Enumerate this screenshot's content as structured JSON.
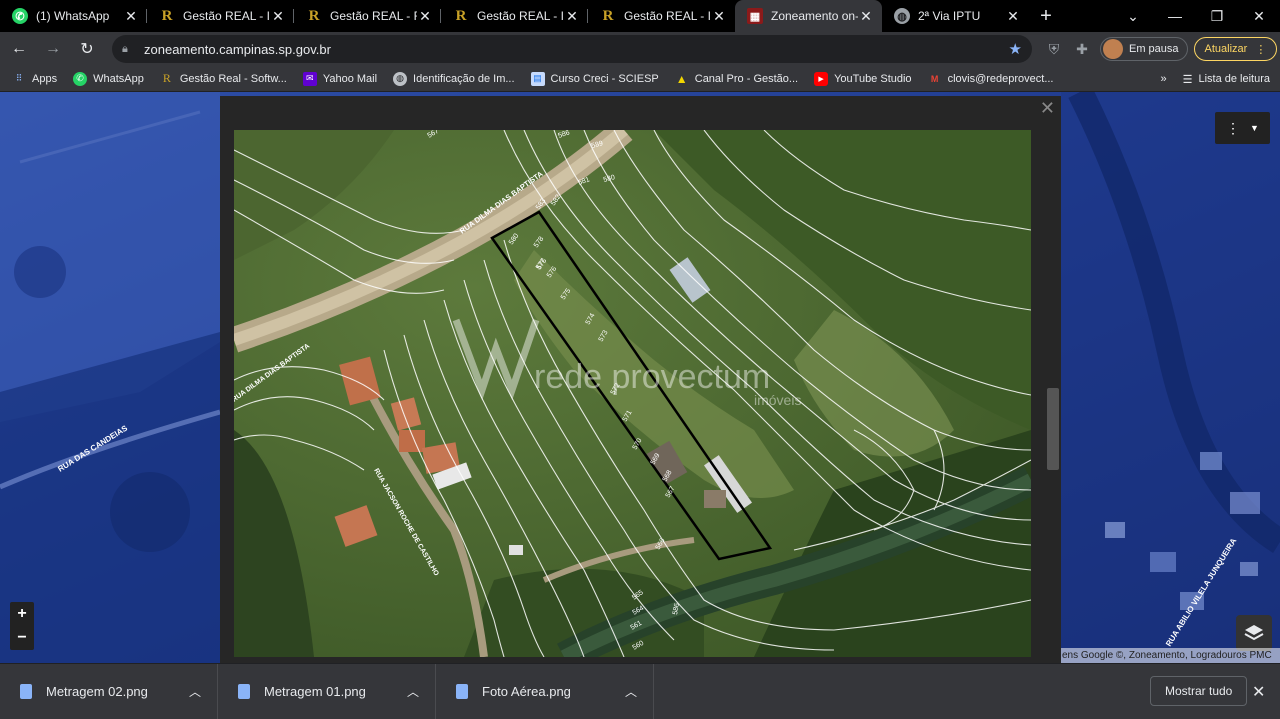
{
  "tabs": [
    {
      "title": "(1) WhatsApp",
      "fav": "whatsapp",
      "active": false
    },
    {
      "title": "Gestão REAL - Im",
      "fav": "r",
      "active": false
    },
    {
      "title": "Gestão REAL - Fic",
      "fav": "r",
      "active": false
    },
    {
      "title": "Gestão REAL - Im",
      "fav": "r",
      "active": false
    },
    {
      "title": "Gestão REAL - Im",
      "fav": "r",
      "active": false
    },
    {
      "title": "Zoneamento on-l",
      "fav": "z",
      "active": true
    },
    {
      "title": "2ª Via IPTU",
      "fav": "globe",
      "active": false
    }
  ],
  "address": {
    "url": "zoneamento.campinas.sp.gov.br"
  },
  "profile": {
    "label": "Em pausa"
  },
  "update": {
    "label": "Atualizar"
  },
  "bookmarks": [
    {
      "label": "Apps",
      "icon": "apps-grid"
    },
    {
      "label": "WhatsApp",
      "icon": "whatsapp"
    },
    {
      "label": "Gestão Real - Softw...",
      "icon": "r"
    },
    {
      "label": "Yahoo Mail",
      "icon": "yahoo"
    },
    {
      "label": "Identificação de Im...",
      "icon": "globe"
    },
    {
      "label": "Curso Creci - SCIESP",
      "icon": "doc"
    },
    {
      "label": "Canal Pro - Gestão...",
      "icon": "canal"
    },
    {
      "label": "YouTube Studio",
      "icon": "youtube"
    },
    {
      "label": "clovis@redeprovect...",
      "icon": "gmail"
    }
  ],
  "reading_list": {
    "label": "Lista de leitura"
  },
  "map": {
    "attribution": "ens Google ©, Zoneamento, Logradouros PMC",
    "bg_labels": [
      "RUA DAS CANDEIAS",
      "RUA ABILIO VILELA JUNQUEIRA"
    ],
    "modal": {
      "street_labels": [
        "RUA DILMA DIAS BAPTISTA",
        "RUA DILMA DIAS BAPTISTA",
        "RUA JACSON ROCHE DE CASTILHO"
      ],
      "watermark": {
        "main": "rede provectum",
        "sub": "imóveis"
      },
      "contour_labels": [
        "567",
        "586",
        "589",
        "581",
        "580",
        "583",
        "582",
        "580",
        "578",
        "576",
        "577",
        "576",
        "575",
        "574",
        "573",
        "572",
        "571",
        "570",
        "569",
        "568",
        "567",
        "566",
        "565",
        "564",
        "561",
        "560",
        "586"
      ]
    }
  },
  "downloads": {
    "items": [
      {
        "name": "Metragem 02.png"
      },
      {
        "name": "Metragem 01.png"
      },
      {
        "name": "Foto Aérea.png"
      }
    ],
    "show_all": "Mostrar tudo"
  },
  "colors": {
    "accent": "#8ab4f8",
    "update": "#fdd663",
    "chrome_dark": "#35363a"
  }
}
